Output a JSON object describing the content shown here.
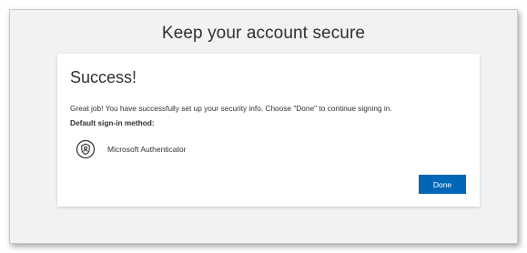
{
  "page": {
    "title": "Keep your account secure"
  },
  "card": {
    "heading": "Success!",
    "message": "Great job! You have successfully set up your security info. Choose \"Done\" to continue signing in.",
    "default_method_label": "Default sign-in method:",
    "method": {
      "icon": "authenticator-icon",
      "label": "Microsoft Authenticator"
    },
    "done_label": "Done"
  },
  "colors": {
    "accent": "#0067b8",
    "background": "#f2f2f2",
    "card": "#ffffff",
    "text": "#323130"
  }
}
